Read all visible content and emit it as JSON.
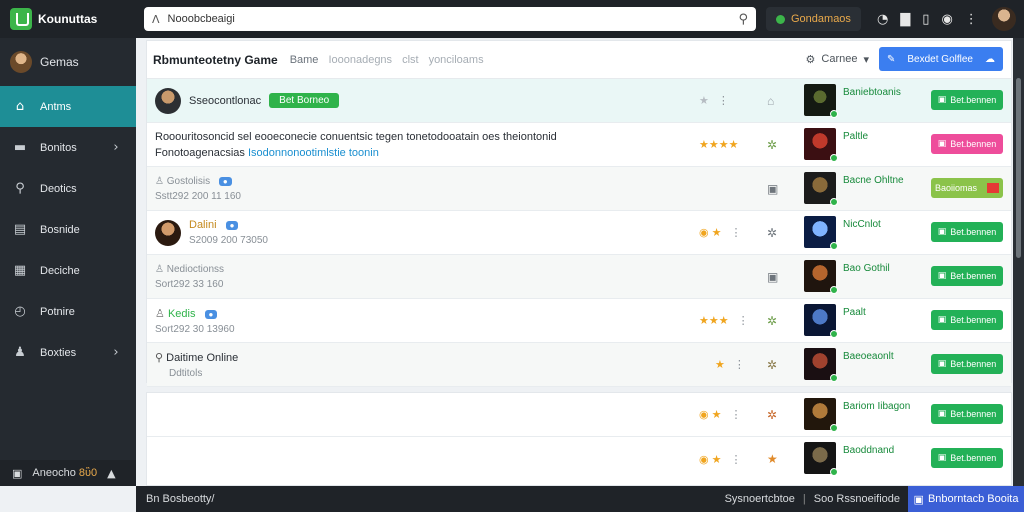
{
  "topbar": {
    "logo_text": "Kounuttas",
    "search_value": "Nooobcbeaigi",
    "games_button": "Gondamaos"
  },
  "sidebar": {
    "user_name": "Gemas",
    "items": [
      {
        "label": "Antms",
        "icon": "home-icon",
        "active": true
      },
      {
        "label": "Bonitos",
        "icon": "controller-icon",
        "has_chevron": true
      },
      {
        "label": "Deotics",
        "icon": "search-icon"
      },
      {
        "label": "Bosnide",
        "icon": "board-icon"
      },
      {
        "label": "Deciche",
        "icon": "grid-icon"
      },
      {
        "label": "Potnire",
        "icon": "clock-icon"
      },
      {
        "label": "Boxties",
        "icon": "person-icon",
        "has_chevron": true
      }
    ],
    "bottom_label": "Aneocho",
    "bottom_highlight": "8ὒ0"
  },
  "main": {
    "title": "Rbmunteotetny Game",
    "crumbs": [
      "Bame",
      "Iooonadegns",
      "clst",
      "yonciloams"
    ],
    "sort_label": "Carnee",
    "primary_button": "Bexdet Golflee",
    "rows": [
      {
        "line1": "Sseocontlonac",
        "line2": "",
        "tag": "Bet Borneo",
        "stars": 1,
        "rating_grey": true,
        "game": "Baniebtoanis",
        "action": "Bet.bennen",
        "action_style": "green",
        "highlight": true
      },
      {
        "line1": "Rooouritosoncid sel eooeconecie conuentsic tegen tonetodooatain oes theiontonid",
        "line2": "Fonotoagenacsias ",
        "line2_link": "Isodonnonootimlstie toonin",
        "stars": 4,
        "game": "Paltle",
        "action": "Bet.bennen",
        "action_style": "pink"
      },
      {
        "line1": "Gostolisis",
        "line2": "Sstt292 200 11 160",
        "badge": "●",
        "game": "Bacne Ohltne",
        "action": "Baoiiomas",
        "action_style": "lime",
        "grey": true
      },
      {
        "line1": "Dalini",
        "line2": "S2009 200 73050",
        "badge": "●",
        "coin": true,
        "game": "NicCnlot",
        "action": "Bet.bennen",
        "action_style": "green"
      },
      {
        "line1": "Nedioctionss",
        "line2": "Sort292 33 160",
        "game": "Bao Gothil",
        "action": "Bet.bennen",
        "action_style": "green",
        "grey": true
      },
      {
        "line1": "Kedis",
        "line2": "Sort292 30 13960",
        "badge": "●",
        "stars": 3,
        "game": "Paalt",
        "action": "Bet.bennen",
        "action_style": "green"
      },
      {
        "line1": "Daitime Online",
        "line2": "Ddtitols",
        "stars": 1,
        "game": "Baeoeaonlt",
        "action": "Bet.bennen",
        "action_style": "green",
        "grey": true
      }
    ]
  },
  "main2": {
    "rows": [
      {
        "coin": true,
        "game": "Bariom Iibagon",
        "action": "Bet.bennen"
      },
      {
        "coin": true,
        "game": "Baoddnand",
        "action": "Bet.bennen"
      }
    ]
  },
  "footer": {
    "left": "Bn Bosbeotty/",
    "mid1": "Sysnoertcbtoe",
    "mid2": "Soo Rssnoeifiode",
    "button": "Bnborntacb Booita"
  }
}
